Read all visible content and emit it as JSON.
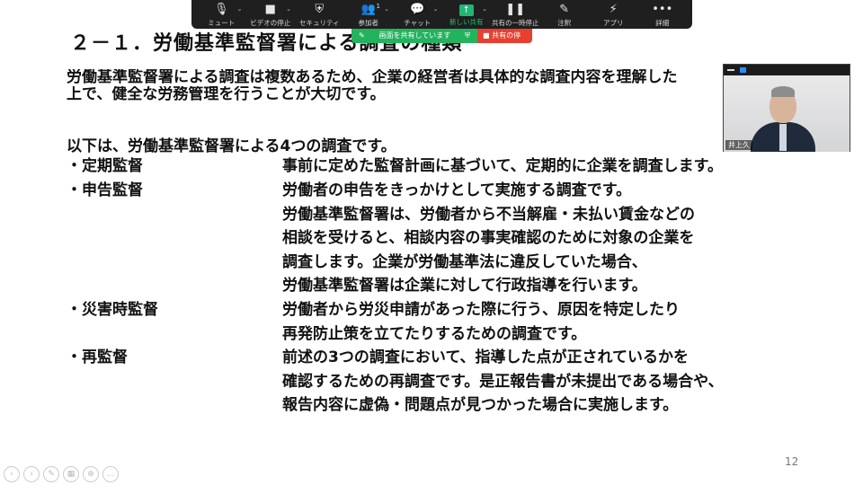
{
  "slide": {
    "title": "２－１．労働基準監督署による調査の種類",
    "intro_lines": [
      "労働基準監督署による調査は複数あるため、企業の経営者は具体的な調査内容を理解した",
      "上で、健全な労務管理を行うことが大切です。"
    ],
    "list_intro": "以下は、労働基準監督署による4つの調査です。",
    "items": [
      {
        "label": "・定期監督",
        "desc": [
          "事前に定めた監督計画に基づいて、定期的に企業を調査します。"
        ]
      },
      {
        "label": "・申告監督",
        "desc": [
          "労働者の申告をきっかけとして実施する調査です。",
          "労働基準監督署は、労働者から不当解雇・未払い賃金などの",
          "相談を受けると、相談内容の事実確認のために対象の企業を",
          "調査します。企業が労働基準法に違反していた場合、",
          "労働基準監督署は企業に対して行政指導を行います。"
        ]
      },
      {
        "label": "・災害時監督",
        "desc": [
          "労働者から労災申請があった際に行う、原因を特定したり",
          "再発防止策を立てたりするための調査です。"
        ]
      },
      {
        "label": "・再監督",
        "desc": [
          "前述の3つの調査において、指導した点が正されているかを",
          "確認するための再調査です。是正報告書が未提出である場合や、",
          "報告内容に虚偽・問題点が見つかった場合に実施します。"
        ]
      }
    ],
    "page_number": "12"
  },
  "toolbar": {
    "buttons": [
      {
        "label": "ミュート",
        "icon": "microphone-icon",
        "glyph": "🎙"
      },
      {
        "label": "ビデオの停止",
        "icon": "video-camera-icon",
        "glyph": "■"
      },
      {
        "label": "セキュリティ",
        "icon": "shield-icon",
        "glyph": "⛨"
      },
      {
        "label": "参加者",
        "icon": "participants-icon",
        "glyph": "👥",
        "count": "1"
      },
      {
        "label": "チャット",
        "icon": "chat-icon",
        "glyph": "💬"
      },
      {
        "label": "新しい共有",
        "icon": "share-screen-icon",
        "glyph": "↑"
      },
      {
        "label": "共有の一時停止",
        "icon": "pause-icon",
        "glyph": "❚❚"
      },
      {
        "label": "注釈",
        "icon": "annotate-pen-icon",
        "glyph": "✎"
      },
      {
        "label": "アプリ",
        "icon": "apps-icon",
        "glyph": "⚡"
      },
      {
        "label": "詳細",
        "icon": "more-icon",
        "glyph": "•••"
      }
    ],
    "caret": "⌄"
  },
  "share_status": {
    "sharing_label": "画面を共有しています",
    "stop_label": "共有の停止"
  },
  "video": {
    "participant_name": "井上久"
  },
  "colors": {
    "toolbar_bg": "#1f1f1f",
    "share_green": "#23b35f",
    "stop_red": "#e8402f"
  }
}
